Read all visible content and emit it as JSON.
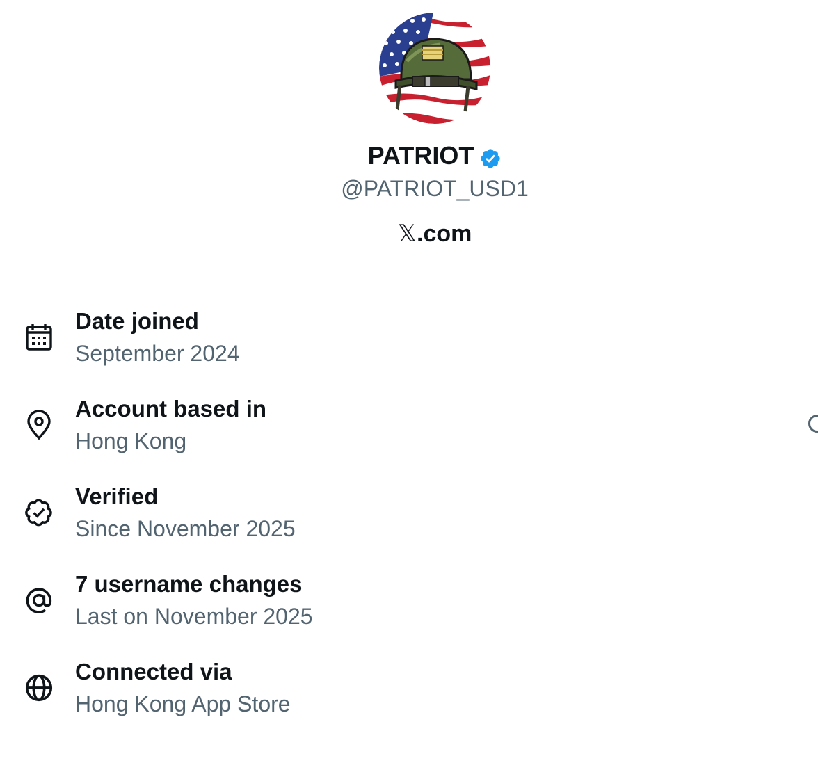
{
  "profile": {
    "name": "PATRIOT",
    "handle": "@PATRIOT_USD1",
    "site_prefix": "𝕏",
    "site_suffix": ".com",
    "avatar_icon": "army-helmet-on-us-flag",
    "verified_icon": "verified-badge-icon",
    "verified_color": "#1d9bf0"
  },
  "about": [
    {
      "icon": "calendar-icon",
      "title": "Date joined",
      "value": "September 2024"
    },
    {
      "icon": "location-pin-icon",
      "title": "Account based in",
      "value": "Hong Kong"
    },
    {
      "icon": "verified-check-icon",
      "title": "Verified",
      "value": "Since November 2025"
    },
    {
      "icon": "at-sign-icon",
      "title": "7 username changes",
      "value": "Last on November 2025"
    },
    {
      "icon": "globe-icon",
      "title": "Connected via",
      "value": "Hong Kong App Store"
    }
  ],
  "colors": {
    "primary_text": "#0f1419",
    "secondary_text": "#536471",
    "accent": "#1d9bf0",
    "background": "#ffffff"
  }
}
